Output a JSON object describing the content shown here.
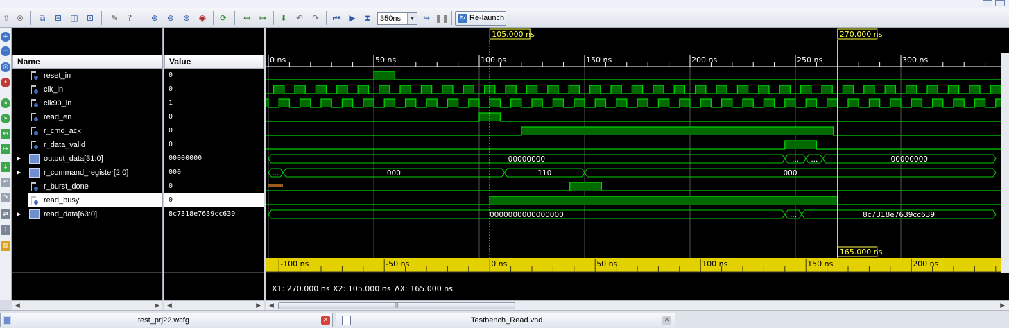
{
  "toolbar": {
    "zoom_value": "350ns",
    "relaunch_label": "Re-launch"
  },
  "waveform": {
    "columns": {
      "name": "Name",
      "value": "Value"
    },
    "rows": [
      {
        "name": "reset_in",
        "value": "0",
        "kind": "bit",
        "expandable": false
      },
      {
        "name": "clk_in",
        "value": "0",
        "kind": "bit",
        "expandable": false
      },
      {
        "name": "clk90_in",
        "value": "1",
        "kind": "bit",
        "expandable": false
      },
      {
        "name": "read_en",
        "value": "0",
        "kind": "bit",
        "expandable": false
      },
      {
        "name": "r_cmd_ack",
        "value": "0",
        "kind": "bit",
        "expandable": false
      },
      {
        "name": "r_data_valid",
        "value": "0",
        "kind": "bit",
        "expandable": false
      },
      {
        "name": "output_data[31:0]",
        "value": "00000000",
        "kind": "bus",
        "expandable": true
      },
      {
        "name": "r_command_register[2:0]",
        "value": "000",
        "kind": "bus",
        "expandable": true
      },
      {
        "name": "r_burst_done",
        "value": "0",
        "kind": "bit",
        "expandable": false
      },
      {
        "name": "read_busy",
        "value": "0",
        "kind": "bit",
        "expandable": false,
        "selected": true
      },
      {
        "name": "read_data[63:0]",
        "value": "8c7318e7639cc639",
        "kind": "bus",
        "expandable": true
      }
    ],
    "time_axis": {
      "labels": [
        "0 ns",
        "50 ns",
        "100 ns",
        "150 ns",
        "200 ns",
        "250 ns",
        "300 ns"
      ]
    },
    "relative_axis": {
      "labels": [
        "-100 ns",
        "-50 ns",
        "0 ns",
        "50 ns",
        "100 ns",
        "150 ns",
        "200 ns"
      ]
    },
    "markers": {
      "cursor1": "270.000 ns",
      "cursor2": "105.000 ns",
      "delta": "165.000 ns"
    },
    "bus_labels": {
      "output_data": [
        "00000000",
        "...",
        "...",
        "00000000"
      ],
      "r_command_register": [
        "...",
        "000",
        "110",
        "000"
      ],
      "read_data": [
        "0000000000000000",
        "...",
        "8c7318e7639cc639"
      ]
    },
    "status": {
      "x1": "X1: 270.000 ns",
      "x2": "X2: 105.000 ns",
      "dx": "ΔX: 165.000 ns"
    },
    "colors": {
      "trace": "#00d000",
      "cursor": "#ffff40",
      "axis_band": "#e4d100",
      "background": "#000000"
    }
  },
  "tabs": [
    {
      "label": "test_prj22.wcfg"
    },
    {
      "label": "Testbench_Read.vhd"
    }
  ]
}
